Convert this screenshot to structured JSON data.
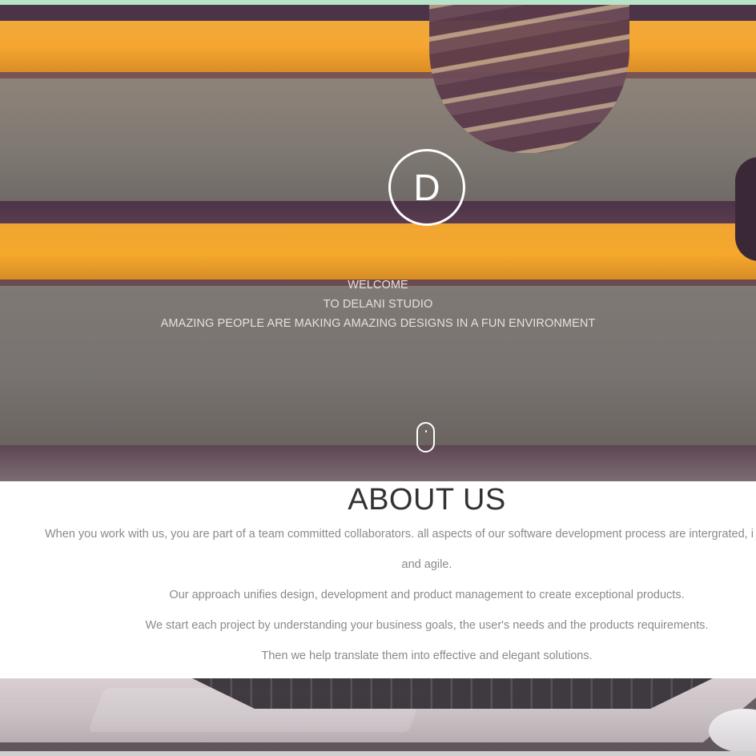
{
  "hero": {
    "logo_letter": "D",
    "line1": "WELCOME",
    "line2": "TO DELANI STUDIO",
    "line3": "AMAZING PEOPLE ARE MAKING AMAZING DESIGNS IN A FUN ENVIRONMENT",
    "scroll_icon": "mouse-scroll-icon"
  },
  "about": {
    "title": "ABOUT US",
    "paragraphs": [
      "When you work with us, you are part of a team committed collaborators. all aspects of our software development process are intergrated, i",
      "and agile.",
      "Our approach unifies design, development and product management to create exceptional products.",
      "We start each project by understanding your business goals, the user's needs and the products requirements.",
      "Then we help translate them into effective and elegant solutions."
    ]
  },
  "colors": {
    "accent_strip": "#b5e4c8",
    "hero_text": "#e7e1dd",
    "about_title": "#333333",
    "about_text": "#8a8a8a"
  }
}
